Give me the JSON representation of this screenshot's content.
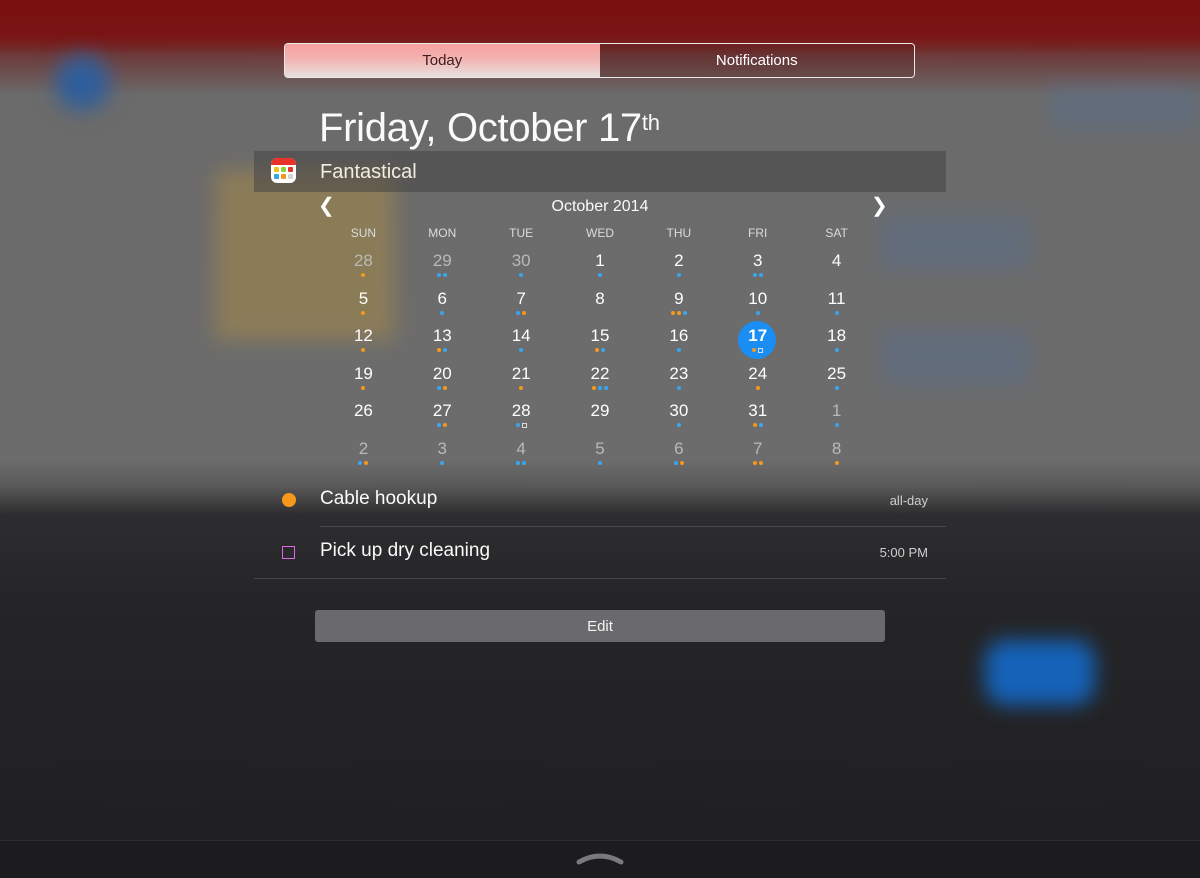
{
  "tabs": [
    {
      "label": "Today",
      "active": true
    },
    {
      "label": "Notifications",
      "active": false
    }
  ],
  "date_heading": {
    "text": "Friday, October 17",
    "suffix": "th"
  },
  "widget": {
    "app_name": "Fantastical",
    "icon": "fantastical-icon"
  },
  "calendar": {
    "month_title": "October 2014",
    "prev_icon": "chevron-left-icon",
    "next_icon": "chevron-right-icon",
    "weekdays": [
      "SUN",
      "MON",
      "TUE",
      "WED",
      "THU",
      "FRI",
      "SAT"
    ],
    "weeks": [
      [
        {
          "day": "28",
          "current_month": false,
          "dots": [
            "o"
          ]
        },
        {
          "day": "29",
          "current_month": false,
          "dots": [
            "b",
            "b"
          ]
        },
        {
          "day": "30",
          "current_month": false,
          "dots": [
            "b"
          ]
        },
        {
          "day": "1",
          "current_month": true,
          "dots": [
            "b"
          ]
        },
        {
          "day": "2",
          "current_month": true,
          "dots": [
            "b"
          ]
        },
        {
          "day": "3",
          "current_month": true,
          "dots": [
            "b",
            "b"
          ]
        },
        {
          "day": "4",
          "current_month": true,
          "dots": []
        }
      ],
      [
        {
          "day": "5",
          "current_month": true,
          "dots": [
            "o"
          ]
        },
        {
          "day": "6",
          "current_month": true,
          "dots": [
            "b"
          ]
        },
        {
          "day": "7",
          "current_month": true,
          "dots": [
            "b",
            "o"
          ]
        },
        {
          "day": "8",
          "current_month": true,
          "dots": []
        },
        {
          "day": "9",
          "current_month": true,
          "dots": [
            "o",
            "o",
            "b"
          ]
        },
        {
          "day": "10",
          "current_month": true,
          "dots": [
            "b"
          ]
        },
        {
          "day": "11",
          "current_month": true,
          "dots": [
            "b"
          ]
        }
      ],
      [
        {
          "day": "12",
          "current_month": true,
          "dots": [
            "o"
          ]
        },
        {
          "day": "13",
          "current_month": true,
          "dots": [
            "o",
            "b"
          ]
        },
        {
          "day": "14",
          "current_month": true,
          "dots": [
            "b"
          ]
        },
        {
          "day": "15",
          "current_month": true,
          "dots": [
            "o",
            "b"
          ]
        },
        {
          "day": "16",
          "current_month": true,
          "dots": [
            "b"
          ]
        },
        {
          "day": "17",
          "current_month": true,
          "today": true,
          "dots": [
            "o",
            "t"
          ]
        },
        {
          "day": "18",
          "current_month": true,
          "dots": [
            "b"
          ]
        }
      ],
      [
        {
          "day": "19",
          "current_month": true,
          "dots": [
            "o"
          ]
        },
        {
          "day": "20",
          "current_month": true,
          "dots": [
            "b",
            "o"
          ]
        },
        {
          "day": "21",
          "current_month": true,
          "dots": [
            "o"
          ]
        },
        {
          "day": "22",
          "current_month": true,
          "dots": [
            "o",
            "b",
            "b"
          ]
        },
        {
          "day": "23",
          "current_month": true,
          "dots": [
            "b"
          ]
        },
        {
          "day": "24",
          "current_month": true,
          "dots": [
            "o"
          ]
        },
        {
          "day": "25",
          "current_month": true,
          "dots": [
            "b"
          ]
        }
      ],
      [
        {
          "day": "26",
          "current_month": true,
          "dots": []
        },
        {
          "day": "27",
          "current_month": true,
          "dots": [
            "b",
            "o"
          ]
        },
        {
          "day": "28",
          "current_month": true,
          "dots": [
            "b",
            "t"
          ]
        },
        {
          "day": "29",
          "current_month": true,
          "dots": []
        },
        {
          "day": "30",
          "current_month": true,
          "dots": [
            "b"
          ]
        },
        {
          "day": "31",
          "current_month": true,
          "dots": [
            "o",
            "b"
          ]
        },
        {
          "day": "1",
          "current_month": false,
          "dots": [
            "b"
          ]
        }
      ],
      [
        {
          "day": "2",
          "current_month": false,
          "dots": [
            "b",
            "o"
          ]
        },
        {
          "day": "3",
          "current_month": false,
          "dots": [
            "b"
          ]
        },
        {
          "day": "4",
          "current_month": false,
          "dots": [
            "b",
            "b"
          ]
        },
        {
          "day": "5",
          "current_month": false,
          "dots": [
            "b"
          ]
        },
        {
          "day": "6",
          "current_month": false,
          "dots": [
            "b",
            "o"
          ]
        },
        {
          "day": "7",
          "current_month": false,
          "dots": [
            "o",
            "o"
          ]
        },
        {
          "day": "8",
          "current_month": false,
          "dots": [
            "o"
          ]
        }
      ]
    ]
  },
  "events": [
    {
      "title": "Cable hookup",
      "time": "all-day",
      "kind": "event",
      "color": "#f7981c"
    },
    {
      "title": "Pick up dry cleaning",
      "time": "5:00 PM",
      "kind": "task",
      "color": "#d96ce6"
    }
  ],
  "edit_label": "Edit",
  "colors": {
    "accent": "#1a8ef3",
    "event_orange": "#f39a1c",
    "event_blue": "#39a7ee"
  },
  "grabber_icon": "grabber-chevron-icon"
}
